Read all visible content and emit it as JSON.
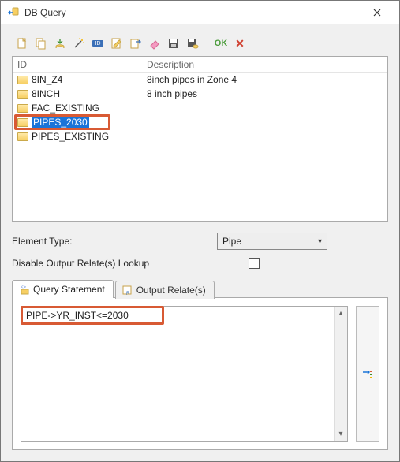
{
  "window": {
    "title": "DB Query"
  },
  "toolbar": {
    "ok_label": "OK"
  },
  "list": {
    "headers": {
      "id": "ID",
      "desc": "Description"
    },
    "items": [
      {
        "id": "8IN_Z4",
        "desc": "8inch pipes in Zone 4"
      },
      {
        "id": "8INCH",
        "desc": "8 inch pipes"
      },
      {
        "id": "FAC_EXISTING",
        "desc": ""
      },
      {
        "id": "PIPES_2030",
        "desc": ""
      },
      {
        "id": "PIPES_EXISTING",
        "desc": ""
      }
    ],
    "selected_index": 3
  },
  "form": {
    "element_type_label": "Element Type:",
    "element_type_value": "Pipe",
    "disable_lookup_label": "Disable Output Relate(s) Lookup",
    "disable_lookup_checked": false
  },
  "tabs": {
    "query": "Query Statement",
    "output": "Output Relate(s)"
  },
  "query": {
    "text": "PIPE->YR_INST<=2030"
  }
}
